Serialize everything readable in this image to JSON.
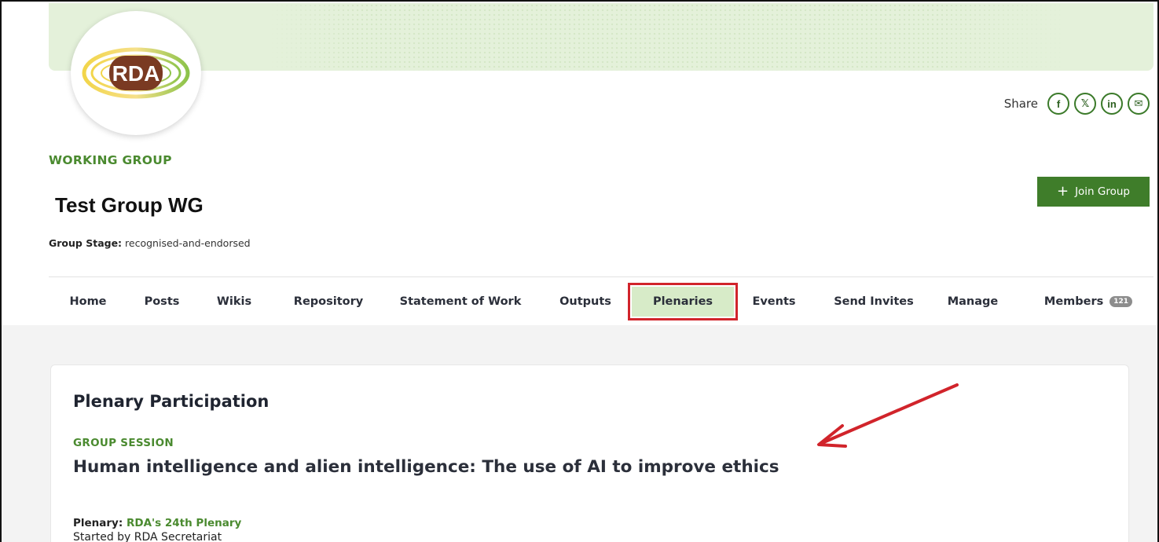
{
  "logo": {
    "text": "RDA"
  },
  "share": {
    "label": "Share",
    "buttons": [
      {
        "name": "facebook",
        "glyph": "f"
      },
      {
        "name": "x",
        "glyph": "𝕏"
      },
      {
        "name": "linkedin",
        "glyph": "in"
      },
      {
        "name": "email",
        "glyph": "✉"
      }
    ]
  },
  "group": {
    "type_label": "WORKING GROUP",
    "title": "Test Group WG",
    "stage_label": "Group Stage:",
    "stage_value": "recognised-and-endorsed",
    "join_label": "Join Group"
  },
  "tabs": [
    {
      "label": "Home"
    },
    {
      "label": "Posts"
    },
    {
      "label": "Wikis"
    },
    {
      "label": "Repository"
    },
    {
      "label": "Statement of Work"
    },
    {
      "label": "Outputs"
    },
    {
      "label": "Plenaries",
      "active": true
    },
    {
      "label": "Events"
    },
    {
      "label": "Send Invites"
    },
    {
      "label": "Manage"
    },
    {
      "label": "Members",
      "badge": "121"
    }
  ],
  "plenary": {
    "heading": "Plenary Participation",
    "session_type": "GROUP SESSION",
    "session_title": "Human intelligence and alien intelligence: The use of AI to improve ethics",
    "plenary_label": "Plenary:",
    "plenary_link": "RDA's 24th Plenary",
    "started_by": "Started by RDA Secretariat"
  },
  "colors": {
    "accent_green": "#3f7d2a",
    "label_green": "#4a8a2f",
    "highlight_red": "#d1242b",
    "active_tab_bg": "#d7ebc8"
  }
}
